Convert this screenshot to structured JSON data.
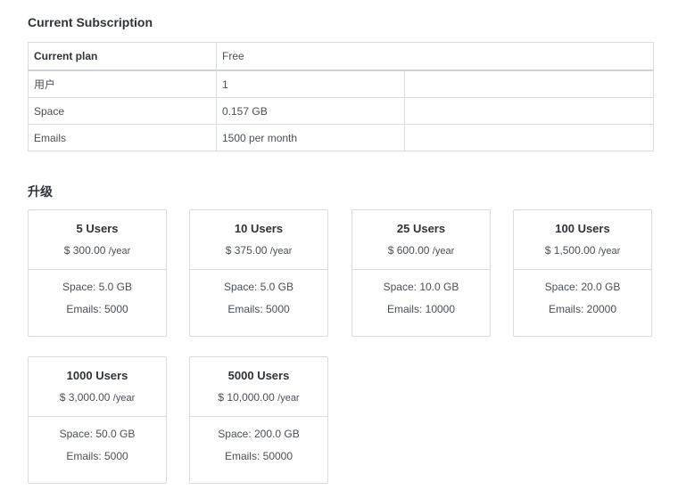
{
  "current_subscription": {
    "title": "Current Subscription",
    "rows": [
      {
        "label": "Current plan",
        "value": "Free"
      },
      {
        "label": "用户",
        "value": "1"
      },
      {
        "label": "Space",
        "value": "0.157 GB"
      },
      {
        "label": "Emails",
        "value": "1500 per month"
      }
    ]
  },
  "upgrade": {
    "title": "升级",
    "plans": [
      {
        "name": "5 Users",
        "price": "$ 300.00",
        "period": "/year",
        "space": "Space: 5.0 GB",
        "emails": "Emails: 5000"
      },
      {
        "name": "10 Users",
        "price": "$ 375.00",
        "period": "/year",
        "space": "Space: 5.0 GB",
        "emails": "Emails: 5000"
      },
      {
        "name": "25 Users",
        "price": "$ 600.00",
        "period": "/year",
        "space": "Space: 10.0 GB",
        "emails": "Emails: 10000"
      },
      {
        "name": "100 Users",
        "price": "$ 1,500.00",
        "period": "/year",
        "space": "Space: 20.0 GB",
        "emails": "Emails: 20000"
      },
      {
        "name": "1000 Users",
        "price": "$ 3,000.00",
        "period": "/year",
        "space": "Space: 50.0 GB",
        "emails": "Emails: 5000"
      },
      {
        "name": "5000 Users",
        "price": "$ 10,000.00",
        "period": "/year",
        "space": "Space: 200.0 GB",
        "emails": "Emails: 50000"
      }
    ]
  }
}
